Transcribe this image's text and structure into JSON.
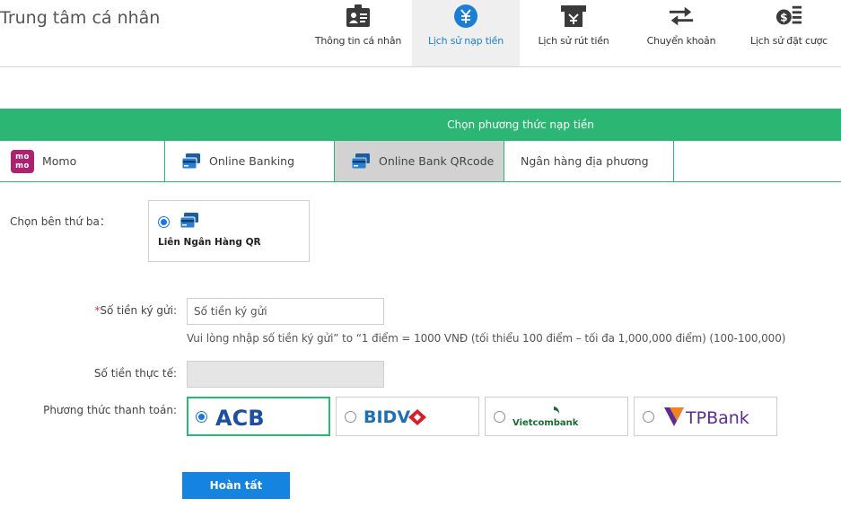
{
  "header": {
    "title": "Trung tâm cá nhân",
    "nav": [
      {
        "label": "Thông tin cá nhân",
        "icon": "id-card-icon"
      },
      {
        "label": "Lịch sử nạp tiền",
        "icon": "yen-circle-icon",
        "active": true
      },
      {
        "label": "Lịch sử rút tiền",
        "icon": "atm-withdraw-icon"
      },
      {
        "label": "Chuyển khoản",
        "icon": "transfer-arrows-icon"
      },
      {
        "label": "Lịch sử đặt cược",
        "icon": "coin-list-icon"
      }
    ]
  },
  "deposit": {
    "method_title": "Chọn phương thức nạp tiền",
    "tabs": [
      {
        "label": "Momo",
        "icon": "momo-logo",
        "logo_text": "mo mo"
      },
      {
        "label": "Online Banking",
        "icon": "bank-card-icon"
      },
      {
        "label": "Online Bank QRcode",
        "icon": "bank-card-icon",
        "active": true
      },
      {
        "label": "Ngân hàng địa phương"
      }
    ],
    "third_party_label": "Chọn bên thứ ba：",
    "third_party_option": "Liên Ngân Hàng QR",
    "amount_required_mark": "*",
    "amount_label": "Số tiền ký gửi:",
    "amount_placeholder": "Số tiền ký gửi",
    "amount_hint": "Vui lòng nhập số tiền ký gửi” to “1 điểm = 1000 VNĐ (tối thiểu 100 điểm – tối đa 1,000,000 điểm) (100-100,000)",
    "actual_label": "Số tiền thực tế:",
    "payment_label": "Phương thức thanh toán:",
    "banks": [
      {
        "name": "ACB",
        "selected": true
      },
      {
        "name": "BIDV"
      },
      {
        "name": "Vietcombank"
      },
      {
        "name": "TPBank"
      }
    ],
    "submit_label": "Hoàn tất"
  },
  "colors": {
    "green": "#2bb673",
    "blue": "#1583e0",
    "active_link": "#1a7fd4",
    "acb_blue": "#1d4fa1",
    "bidv_blue": "#1f6fb3",
    "bidv_red": "#d71e2a",
    "vcb_green": "#1a6b32",
    "tpbank_purple": "#5c2d91",
    "tpbank_orange": "#f58220"
  }
}
